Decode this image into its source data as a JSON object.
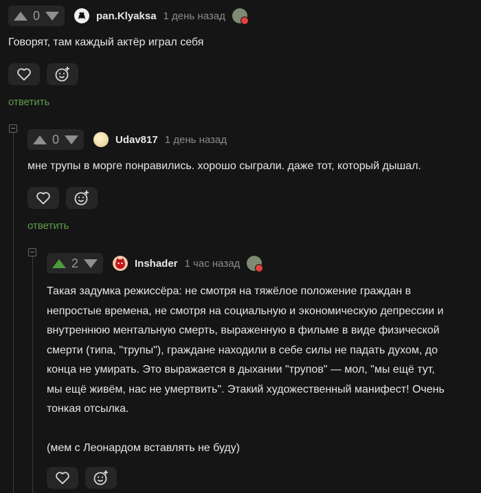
{
  "comments": [
    {
      "score": "0",
      "username": "pan.Klyaksa",
      "time": "1 день назад",
      "text": "Говорят, там каждый актёр играл себя",
      "reply_label": "ответить"
    },
    {
      "score": "0",
      "username": "Udav817",
      "time": "1 день назад",
      "text": "мне трупы в морге понравились. хорошо сыграли. даже тот, который дышал.",
      "reply_label": "ответить"
    },
    {
      "score": "2",
      "username": "Inshader",
      "time": "1 час назад",
      "text_lines": [
        "Такая задумка режиссёра: не смотря на тяжёлое положение граждан в",
        "непростые времена, не смотря на социальную и экономическую депрессии и",
        "внутреннюю ментальную смерть, выраженную в фильме в виде физической",
        "смерти (типа, \"трупы\"), граждане находили в себе силы не падать духом, до",
        "конца не умирать. Это выражается в дыхании \"трупов\" — мол, \"мы ещё тут,",
        "мы ещё живём, нас не умертвить\". Этакий художественный манифест! Очень",
        "тонкая отсылка.",
        "",
        "(мем с Леонардом вставлять не буду)"
      ]
    }
  ],
  "colors": {
    "background": "#151515",
    "panel": "#262626",
    "accent_green": "#5e9e4a",
    "upvote_active": "#4e9a3e"
  },
  "icons": [
    "arrow-up-icon",
    "arrow-down-icon",
    "heart-icon",
    "emoji-add-icon",
    "collapse-icon",
    "award-badge-icon"
  ]
}
